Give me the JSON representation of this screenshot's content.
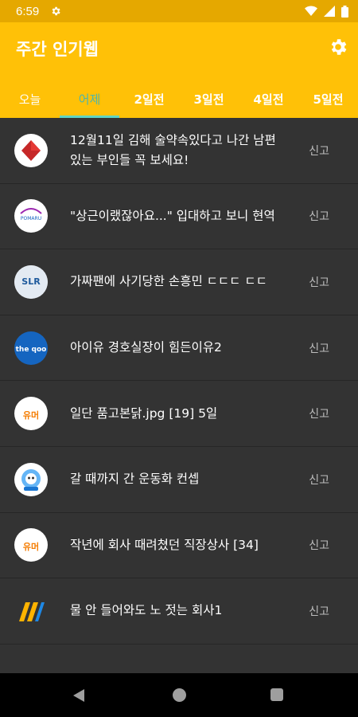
{
  "status_bar": {
    "time": "6:59"
  },
  "app_bar": {
    "title": "주간 인기웹"
  },
  "tabs": [
    {
      "label": "오늘"
    },
    {
      "label": "어제"
    },
    {
      "label": "2일전"
    },
    {
      "label": "3일전"
    },
    {
      "label": "4일전"
    },
    {
      "label": "5일전"
    }
  ],
  "active_tab": "어제",
  "colors": {
    "app_bar": "#FFC107",
    "status_bar": "#E5A800",
    "tab_indicator": "#5FD3C4",
    "background": "#333333"
  },
  "report_label": "신고",
  "posts": [
    {
      "title": "12월11일 김해 술약속있다고 나간 남편있는 부인들 꼭 보세요!",
      "source_icon": "red-diamond-logo-icon"
    },
    {
      "title": "\"상근이랬잖아요...\" 입대하고 보니 현역",
      "source_icon": "site-logo-icon",
      "logo_text": "POMARU"
    },
    {
      "title": "가짜팬에 사기당한 손흥민 ㄷㄷㄷ ㄷㄷ",
      "source_icon": "slr-logo-icon",
      "logo_text": "SLR"
    },
    {
      "title": "아이유 경호실장이 힘든이유2",
      "source_icon": "theqoo-logo-icon",
      "logo_text": "the qoo"
    },
    {
      "title": "일단 품고본닭.jpg [19] 5일",
      "source_icon": "humor-logo-icon",
      "logo_text": "유머"
    },
    {
      "title": "갈 때까지 간 운동화 컨셉",
      "source_icon": "mascot-logo-icon"
    },
    {
      "title": "작년에 회사 때려쳤던 직장상사 [34]",
      "source_icon": "humor-logo-icon",
      "logo_text": "유머"
    },
    {
      "title": "물 안 들어와도 노 젓는 회사1",
      "source_icon": "striped-logo-icon"
    }
  ]
}
